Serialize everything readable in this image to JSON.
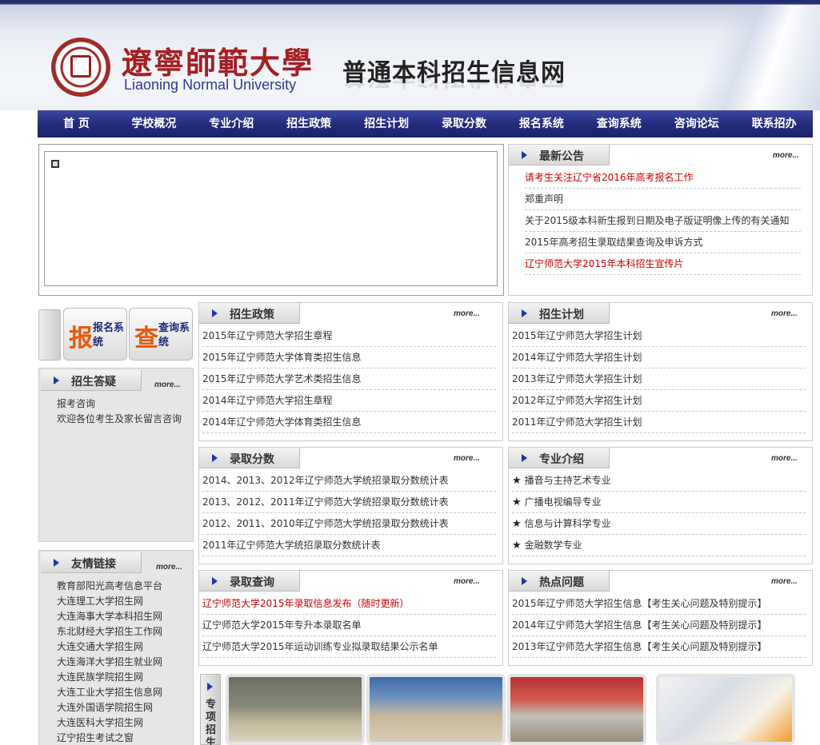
{
  "header": {
    "logo_cn": "遼寧師範大學",
    "logo_en": "Liaoning Normal University",
    "site_title": "普通本科招生信息网"
  },
  "nav": [
    "首 页",
    "学校概况",
    "专业介绍",
    "招生政策",
    "招生计划",
    "录取分数",
    "报名系统",
    "查询系统",
    "咨询论坛",
    "联系招办"
  ],
  "more_label": "more...",
  "announcements": {
    "title": "最新公告",
    "items": [
      {
        "text": "请考生关注辽宁省2016年高考报名工作",
        "red": true
      },
      {
        "text": "郑重声明",
        "red": false
      },
      {
        "text": "关于2015级本科新生报到日期及电子版证明像上传的有关通知",
        "red": false
      },
      {
        "text": "2015年高考招生录取结果查询及申诉方式",
        "red": false
      },
      {
        "text": "辽宁师范大学2015年本科招生宣传片",
        "red": true
      }
    ]
  },
  "systems": {
    "signup": {
      "big": "报",
      "small": "报名系统"
    },
    "query": {
      "big": "查",
      "small": "查询系统"
    }
  },
  "faq": {
    "title": "招生答疑",
    "items": [
      "报考咨询",
      "欢迎各位考生及家长留言咨询"
    ]
  },
  "links": {
    "title": "友情链接",
    "items": [
      "教育部阳光高考信息平台",
      "大连理工大学招生网",
      "大连海事大学本科招生网",
      "东北财经大学招生工作网",
      "大连交通大学招生网",
      "大连海洋大学招生就业网",
      "大连民族学院招生网",
      "大连工业大学招生信息网",
      "大连外国语学院招生网",
      "大连医科大学招生网",
      "辽宁招生考试之窗"
    ]
  },
  "policy": {
    "title": "招生政策",
    "items": [
      "2015年辽宁师范大学招生章程",
      "2015年辽宁师范大学体育类招生信息",
      "2015年辽宁师范大学艺术类招生信息",
      "2014年辽宁师范大学招生章程",
      "2014年辽宁师范大学体育类招生信息"
    ]
  },
  "plan": {
    "title": "招生计划",
    "items": [
      "2015年辽宁师范大学招生计划",
      "2014年辽宁师范大学招生计划",
      "2013年辽宁师范大学招生计划",
      "2012年辽宁师范大学招生计划",
      "2011年辽宁师范大学招生计划"
    ]
  },
  "scores": {
    "title": "录取分数",
    "items": [
      "2014、2013、2012年辽宁师范大学统招录取分数统计表",
      "2013、2012、2011年辽宁师范大学统招录取分数统计表",
      "2012、2011、2010年辽宁师范大学统招录取分数统计表",
      "2011年辽宁师范大学统招录取分数统计表"
    ]
  },
  "majors": {
    "title": "专业介绍",
    "star": "★",
    "items": [
      "播音与主持艺术专业",
      "广播电视编导专业",
      "信息与计算科学专业",
      "金融数学专业"
    ]
  },
  "query": {
    "title": "录取查询",
    "items": [
      {
        "text": "辽宁师范大学2015年录取信息发布（随时更新）",
        "red": true
      },
      {
        "text": "辽宁师范大学2015年专升本录取名单",
        "red": false
      },
      {
        "text": "辽宁师范大学2015年运动训练专业拟录取结果公示名单",
        "red": false
      }
    ]
  },
  "hot": {
    "title": "热点问题",
    "items": [
      "2015年辽宁师范大学招生信息【考生关心问题及特别提示】",
      "2014年辽宁师范大学招生信息【考生关心问题及特别提示】",
      "2013年辽宁师范大学招生信息【考生关心问题及特别提示】"
    ]
  },
  "photos": {
    "label": "专项招生"
  }
}
